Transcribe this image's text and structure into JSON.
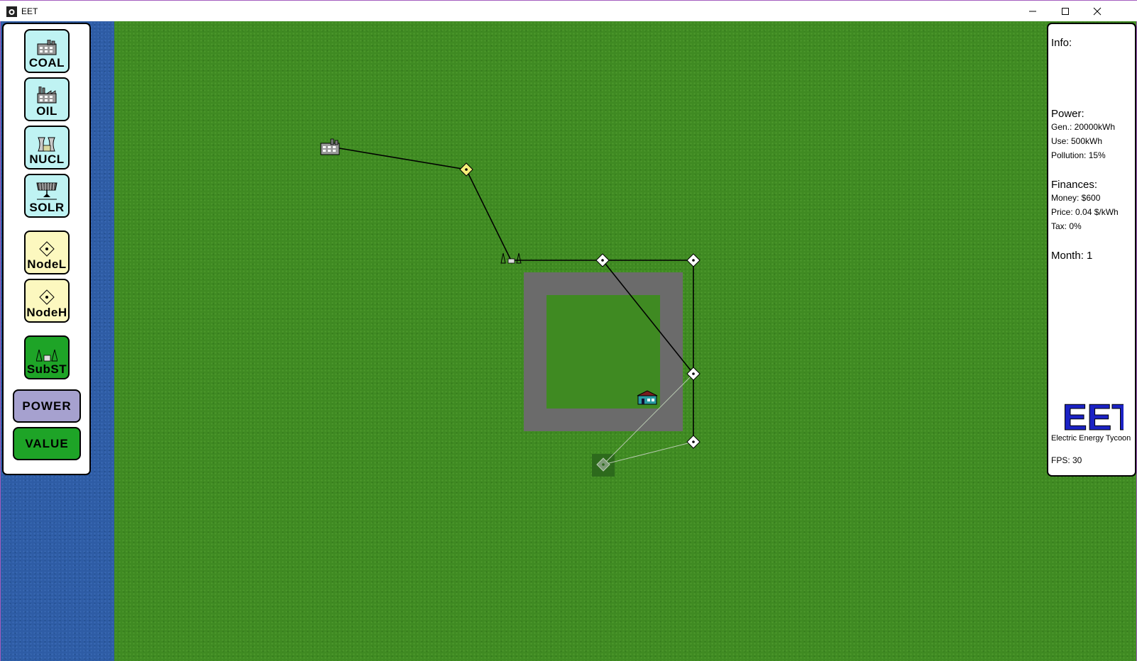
{
  "window": {
    "title": "EET"
  },
  "toolbar": {
    "coal": "COAL",
    "oil": "OIL",
    "nucl": "NUCL",
    "solr": "SOLR",
    "nodel": "NodeL",
    "nodeh": "NodeH",
    "subst": "SubST",
    "power": "POWER",
    "value": "VALUE"
  },
  "info": {
    "heading": "Info:",
    "power_heading": "Power:",
    "gen": "Gen.: 20000kWh",
    "use": "Use:  500kWh",
    "pollution": "Pollution:  15%",
    "finances_heading": "Finances:",
    "money": "Money: $600",
    "price": "Price:  0.04 $/kWh",
    "tax": "Tax:   0%",
    "month": "Month: 1",
    "logo_text": "EET",
    "logo_subtitle": "Electric Energy Tycoon",
    "fps": "FPS:  30"
  },
  "colors": {
    "grass": "#3f8a22",
    "water": "#2e5ca5",
    "road": "#6b6b6b",
    "tool_cyan": "#bff3f3",
    "tool_yellow": "#fcf8bf",
    "tool_green": "#1ea427",
    "power_button": "#a6a1cf",
    "value_button": "#1ea427",
    "logo_blue": "#1b22c4",
    "logo_green": "#2f8a3d"
  },
  "icons": [
    "app-icon",
    "minimize-icon",
    "maximize-icon",
    "close-icon",
    "coal-plant-icon",
    "oil-plant-icon",
    "nuclear-plant-icon",
    "solar-panel-icon",
    "node-icon",
    "substation-icon",
    "house-icon"
  ]
}
